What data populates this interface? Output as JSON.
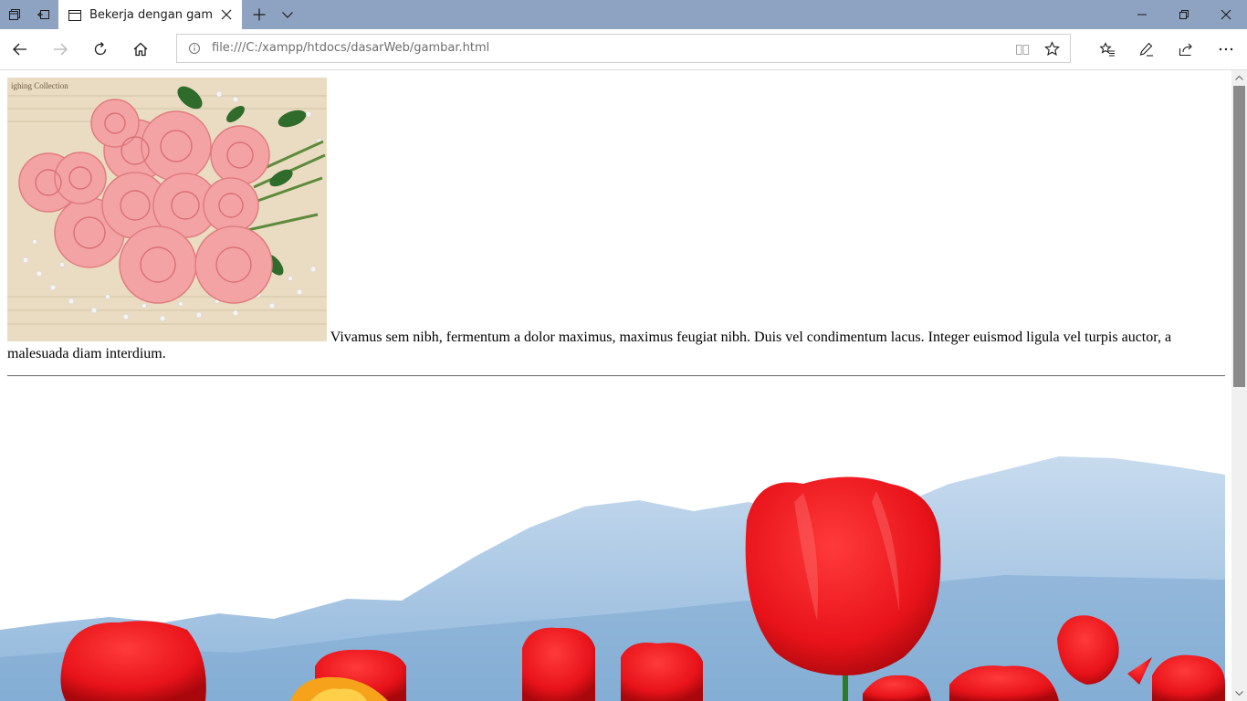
{
  "browser": {
    "tab_title": "Bekerja dengan gambar",
    "address": "file:///C:/xampp/htdocs/dasarWeb/gambar.html"
  },
  "page": {
    "paragraph_text": "Vivamus sem nibh, fermentum a dolor maximus, maximus feugiat nibh. Duis vel condimentum lacus. Integer euismod ligula vel turpis auctor, a malesuada diam interdium.",
    "newspaper_text": "ighing Collection"
  },
  "colors": {
    "titlebar": "#8ea3c2",
    "tulip_red": "#e8131a",
    "sky": "#dfeaf6",
    "rose_pink": "#f4a3a5"
  },
  "icons": {
    "tab_aside": "tab-aside-icon",
    "back": "back-arrow-icon",
    "forward": "forward-arrow-icon",
    "refresh": "refresh-icon",
    "home": "home-icon",
    "favorite": "star-icon"
  }
}
